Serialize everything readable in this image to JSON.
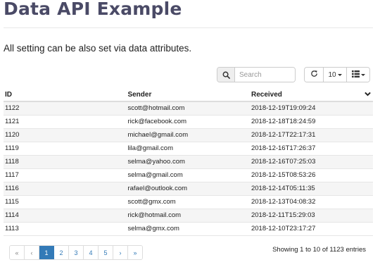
{
  "page": {
    "title": "Data API Example",
    "subtitle": "All setting can be also set via data attributes."
  },
  "toolbar": {
    "search_placeholder": "Search",
    "page_size": "10",
    "icons": {
      "search": "search-icon",
      "refresh": "refresh-icon",
      "columns": "columns-icon"
    }
  },
  "table": {
    "columns": [
      "ID",
      "Sender",
      "Received"
    ],
    "rows": [
      [
        "1122",
        "scott@hotmail.com",
        "2018-12-19T19:09:24"
      ],
      [
        "1121",
        "rick@facebook.com",
        "2018-12-18T18:24:59"
      ],
      [
        "1120",
        "michael@gmail.com",
        "2018-12-17T22:17:31"
      ],
      [
        "1119",
        "lila@gmail.com",
        "2018-12-16T17:26:37"
      ],
      [
        "1118",
        "selma@yahoo.com",
        "2018-12-16T07:25:03"
      ],
      [
        "1117",
        "selma@gmail.com",
        "2018-12-15T08:53:26"
      ],
      [
        "1116",
        "rafael@outlook.com",
        "2018-12-14T05:11:35"
      ],
      [
        "1115",
        "scott@gmx.com",
        "2018-12-13T04:08:32"
      ],
      [
        "1114",
        "rick@hotmail.com",
        "2018-12-11T15:29:03"
      ],
      [
        "1113",
        "selma@gmx.com",
        "2018-12-10T23:17:27"
      ]
    ]
  },
  "pagination": {
    "items": [
      "«",
      "‹",
      "1",
      "2",
      "3",
      "4",
      "5",
      "›",
      "»"
    ],
    "active": "1",
    "summary": "Showing 1 to 10 of 1123 entries"
  },
  "colors": {
    "accent": "#337ab7",
    "title": "#4a4a66",
    "stripe": "#f5f5f5"
  }
}
